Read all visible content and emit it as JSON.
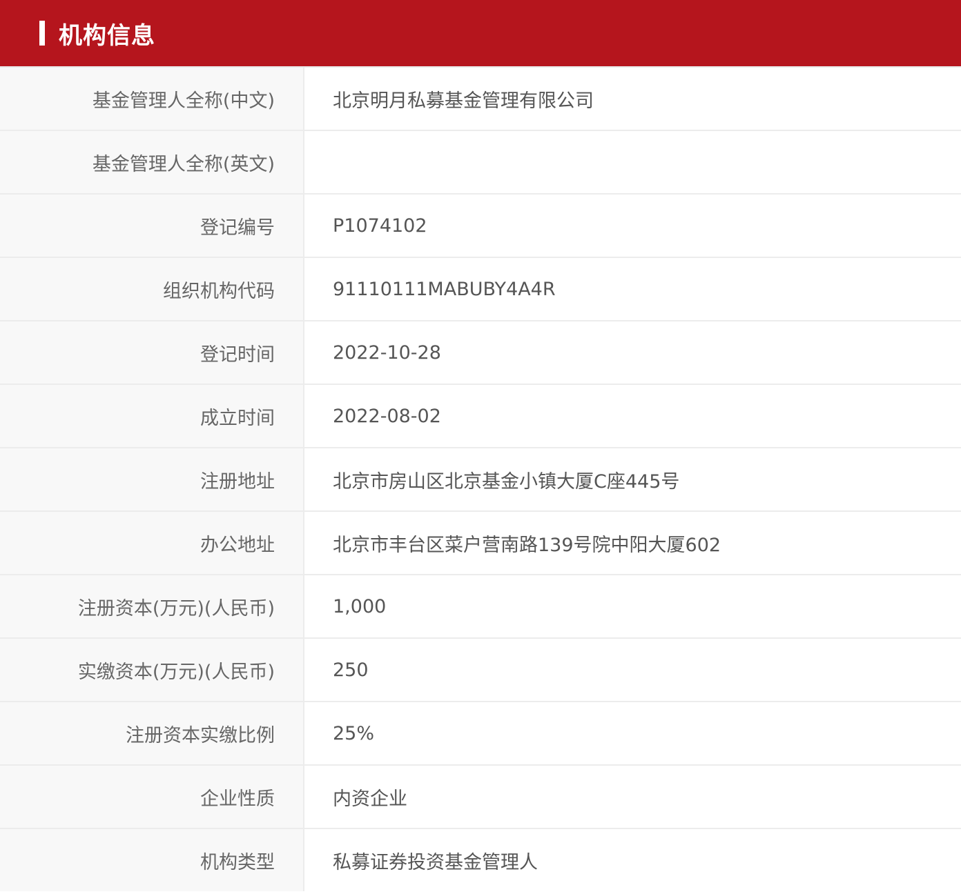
{
  "header": {
    "title": "机构信息",
    "accent_color": "#b5151d"
  },
  "rows": [
    {
      "label": "基金管理人全称(中文)",
      "value": "北京明月私募基金管理有限公司"
    },
    {
      "label": "基金管理人全称(英文)",
      "value": ""
    },
    {
      "label": "登记编号",
      "value": "P1074102"
    },
    {
      "label": "组织机构代码",
      "value": "91110111MABUBY4A4R"
    },
    {
      "label": "登记时间",
      "value": "2022-10-28"
    },
    {
      "label": "成立时间",
      "value": "2022-08-02"
    },
    {
      "label": "注册地址",
      "value": "北京市房山区北京基金小镇大厦C座445号"
    },
    {
      "label": "办公地址",
      "value": "北京市丰台区菜户营南路139号院中阳大厦602"
    },
    {
      "label": "注册资本(万元)(人民币)",
      "value": "1,000"
    },
    {
      "label": "实缴资本(万元)(人民币)",
      "value": "250"
    },
    {
      "label": "注册资本实缴比例",
      "value": "25%"
    },
    {
      "label": "企业性质",
      "value": "内资企业"
    },
    {
      "label": "机构类型",
      "value": "私募证券投资基金管理人"
    }
  ]
}
